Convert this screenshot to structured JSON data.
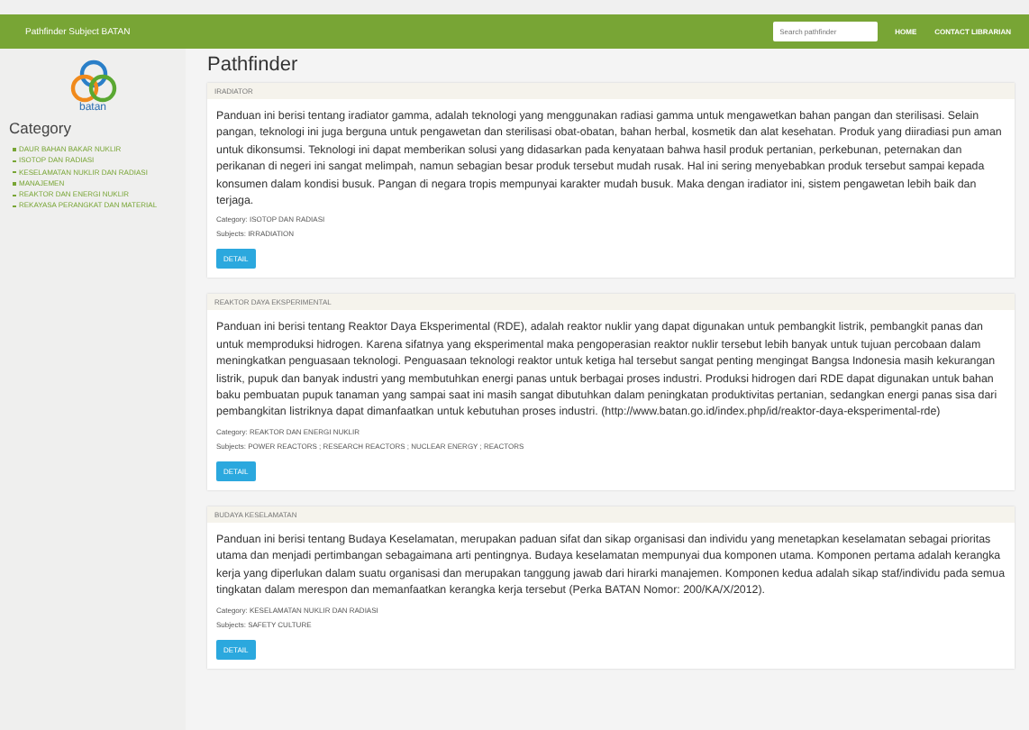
{
  "navbar": {
    "title": "Pathfinder Subject BATAN",
    "search": {
      "placeholder": "Search pathfinder"
    },
    "links": [
      "HOME",
      "CONTACT LIBRARIAN"
    ]
  },
  "sidebar": {
    "logo_text": "batan",
    "heading": "Category",
    "items": [
      "DAUR BAHAN BAKAR NUKLIR",
      "ISOTOP DAN RADIASI",
      "KESELAMATAN NUKLIR DAN RADIASI",
      "MANAJEMEN",
      "REAKTOR DAN ENERGI NUKLIR",
      "REKAYASA PERANGKAT DAN MATERIAL"
    ]
  },
  "page_title": "Pathfinder",
  "cards": [
    {
      "header": "IRADIATOR",
      "text": "Panduan ini berisi tentang iradiator gamma, adalah teknologi yang menggunakan radiasi gamma untuk mengawetkan bahan pangan dan sterilisasi. Selain pangan, teknologi ini juga berguna untuk pengawetan dan sterilisasi obat-obatan, bahan herbal, kosmetik dan alat kesehatan. Produk yang diiradiasi pun aman untuk dikonsumsi. Teknologi ini dapat memberikan solusi yang didasarkan pada kenyataan bahwa hasil produk pertanian, perkebunan, peternakan dan perikanan di negeri ini sangat melimpah, namun sebagian besar produk tersebut mudah rusak. Hal ini sering menyebabkan produk tersebut sampai kepada konsumen dalam kondisi busuk. Pangan di negara tropis mempunyai karakter mudah busuk. Maka dengan iradiator ini, sistem pengawetan lebih baik dan terjaga.",
      "category": "Category: ISOTOP DAN RADIASI",
      "subjects": "Subjects: IRRADIATION",
      "button": "DETAIL"
    },
    {
      "header": "REAKTOR DAYA EKSPERIMENTAL",
      "text": "Panduan ini berisi tentang Reaktor Daya Eksperimental (RDE), adalah reaktor nuklir yang dapat digunakan untuk pembangkit listrik, pembangkit panas dan untuk memproduksi hidrogen. Karena sifatnya yang eksperimental maka pengoperasian reaktor nuklir tersebut lebih banyak untuk tujuan percobaan dalam meningkatkan penguasaan teknologi. Penguasaan teknologi reaktor untuk ketiga hal tersebut sangat penting mengingat Bangsa Indonesia masih kekurangan listrik, pupuk dan banyak industri yang membutuhkan energi panas untuk berbagai proses industri. Produksi hidrogen dari RDE dapat digunakan untuk bahan baku pembuatan pupuk tanaman yang sampai saat ini masih sangat dibutuhkan dalam peningkatan produktivitas pertanian, sedangkan energi panas sisa dari pembangkitan listriknya dapat dimanfaatkan untuk kebutuhan proses industri. (http://www.batan.go.id/index.php/id/reaktor-daya-eksperimental-rde)",
      "category": "Category: REAKTOR DAN ENERGI NUKLIR",
      "subjects": "Subjects: POWER REACTORS ; RESEARCH REACTORS ; NUCLEAR ENERGY ; REACTORS",
      "button": "DETAIL"
    },
    {
      "header": "BUDAYA KESELAMATAN",
      "text": "Panduan ini berisi tentang Budaya Keselamatan, merupakan paduan sifat dan sikap organisasi dan individu yang menetapkan keselamatan sebagai prioritas utama dan menjadi pertimbangan sebagaimana arti pentingnya. Budaya keselamatan mempunyai dua komponen utama. Komponen pertama adalah kerangka kerja yang diperlukan dalam suatu organisasi dan merupakan tanggung jawab dari hirarki manajemen. Komponen kedua adalah sikap staf/individu pada semua tingkatan dalam merespon dan memanfaatkan kerangka kerja tersebut (Perka BATAN Nomor: 200/KA/X/2012).",
      "category": "Category: KESELAMATAN NUKLIR DAN RADIASI",
      "subjects": "Subjects: SAFETY CULTURE",
      "button": "DETAIL"
    }
  ]
}
